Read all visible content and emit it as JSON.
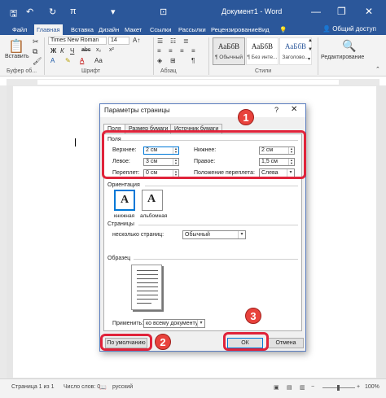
{
  "window": {
    "title": "Документ1 - Word",
    "minimize": "—",
    "restore": "❐",
    "close": "✕",
    "qa_save": "🖫",
    "qa_undo": "↶",
    "qa_redo": "↻",
    "qa_pi": "π",
    "qa_customize": "▾"
  },
  "ribbon": {
    "tabs": [
      "Файл",
      "Главная",
      "Вставка",
      "Дизайн",
      "Макет",
      "Ссылки",
      "Рассылки",
      "Рецензирование",
      "Вид"
    ],
    "active_tab": "Главная",
    "share": "Общий доступ",
    "font_name": "Times New Roman",
    "font_size": "14",
    "paste_label": "Вставить",
    "groups": {
      "clipboard": "Буфер об...",
      "font": "Шрифт",
      "paragraph": "Абзац",
      "styles": "Стили",
      "editing": "Редактирование"
    },
    "font_buttons": [
      "Ж",
      "К",
      "Ч",
      "abc",
      "x₂",
      "x²"
    ],
    "styles": [
      {
        "sample": "АаБбВ",
        "name": "¶ Обычный"
      },
      {
        "sample": "АаБбВ",
        "name": "¶ Без инте..."
      },
      {
        "sample": "АаБбВ",
        "name": "Заголово..."
      }
    ]
  },
  "status": {
    "page": "Страница 1 из 1",
    "words": "Число слов: 0",
    "lang": "русский",
    "zoom": "100%"
  },
  "dialog": {
    "title": "Параметры страницы",
    "help": "?",
    "close": "✕",
    "tabs": [
      "Поля",
      "Размер бумаги",
      "Источник бумаги"
    ],
    "margins_section": "Поля",
    "top_label": "Верхнее:",
    "top_value": "2 см",
    "bottom_label": "Нижнее:",
    "bottom_value": "2 см",
    "left_label": "Левое:",
    "left_value": "3 см",
    "right_label": "Правое:",
    "right_value": "1,5 см",
    "gutter_label": "Переплет:",
    "gutter_value": "0 см",
    "gutter_pos_label": "Положение переплета:",
    "gutter_pos_value": "Слева",
    "orientation_section": "Ориентация",
    "portrait": "книжная",
    "landscape": "альбомная",
    "pages_section": "Страницы",
    "multiple_pages_label": "несколько страниц:",
    "multiple_pages_value": "Обычный",
    "preview_section": "Образец",
    "apply_label": "Применить:",
    "apply_value": "ко всему документу",
    "default_button": "По умолчанию",
    "ok_button": "ОК",
    "cancel_button": "Отмена"
  },
  "annotations": [
    "1",
    "2",
    "3"
  ],
  "colors": {
    "title_bar": "#2b579a",
    "highlight": "#e0233a",
    "badge": "#e8423c"
  }
}
